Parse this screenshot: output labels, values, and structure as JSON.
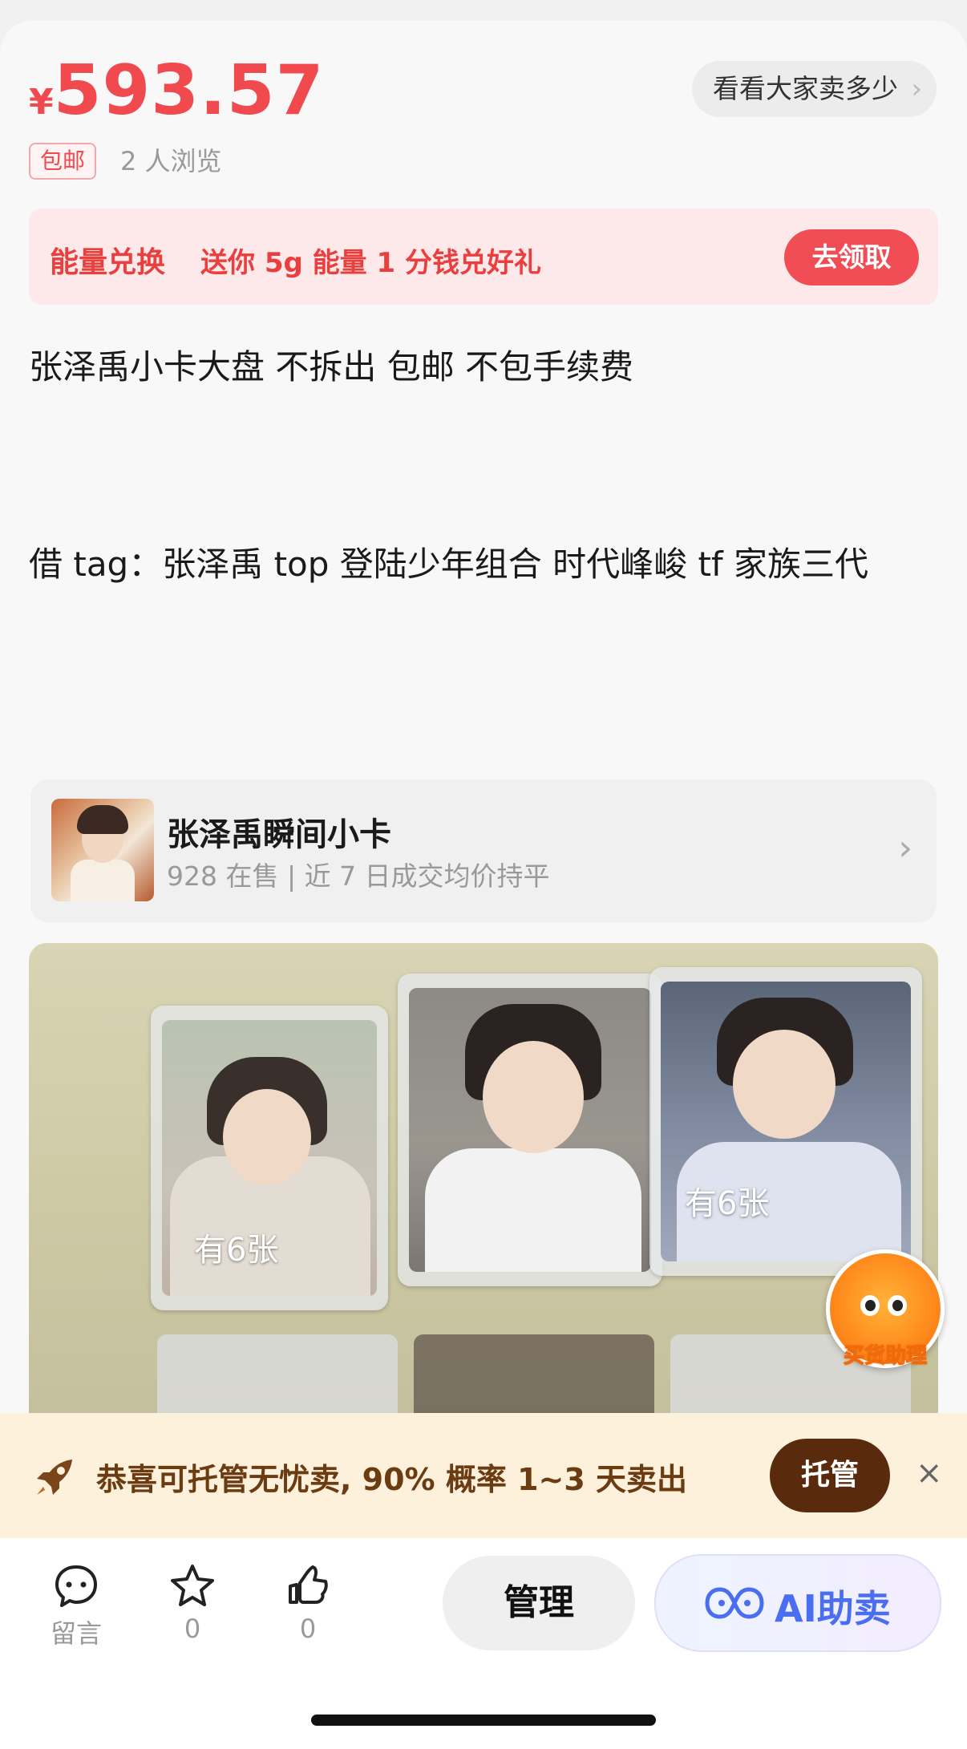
{
  "price": {
    "currency": "¥",
    "amount": "593.57"
  },
  "compare": {
    "label": "看看大家卖多少",
    "chevron": "›"
  },
  "badges": {
    "free_shipping": "包邮",
    "views": "2 人浏览"
  },
  "promo": {
    "title": "能量兑换",
    "text": "送你 5g 能量 1 分钱兑好礼",
    "button": "去领取"
  },
  "description": {
    "line1": "张泽禹小卡大盘 不拆出 包邮 不包手续费",
    "line2": "借 tag：张泽禹 top 登陆少年组合 时代峰峻 tf 家族三代"
  },
  "product_link": {
    "title": "张泽禹瞬间小卡",
    "subtitle": "928 在售 | 近 7 日成交均价持平",
    "chevron": "›"
  },
  "photo_labels": [
    "有6张",
    "有6张"
  ],
  "assistant": {
    "label": "买货助理"
  },
  "hosting": {
    "text": "恭喜可托管无忧卖, 90% 概率 1~3 天卖出",
    "button": "托管",
    "close": "×"
  },
  "bottom_bar": {
    "comment": {
      "label": "留言",
      "icon": "chat-bubble-icon"
    },
    "favorite": {
      "count": "0",
      "icon": "star-icon"
    },
    "like": {
      "count": "0",
      "icon": "thumbs-up-icon"
    },
    "manage": "管理",
    "ai_sell": "AI助卖"
  },
  "colors": {
    "accent": "#f04a4f",
    "hosting_bg": "#fdf1dc",
    "hosting_btn": "#5a2a0d",
    "ai_blue": "#4a6ef0"
  }
}
